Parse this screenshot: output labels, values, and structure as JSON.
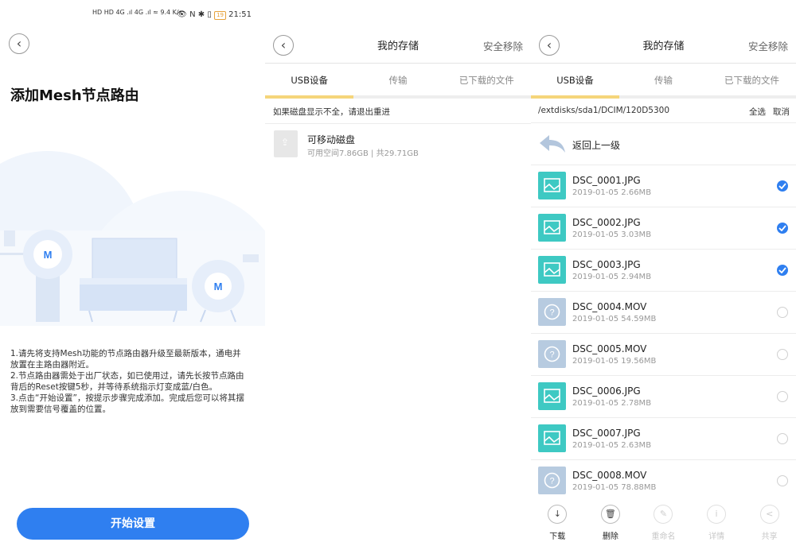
{
  "status_bar": {
    "left_icons": "HD HD 4G .ıl 4G .ıl ≈ 9.4 K/s",
    "right_text": "21:51",
    "battery": "19"
  },
  "panel1": {
    "title": "添加Mesh节点路由",
    "node_logo": "M",
    "instructions": [
      "1.请先将支持Mesh功能的节点路由器升级至最新版本，通电并放置在主路由器附近。",
      "2.节点路由器需处于出厂状态，如已使用过，请先长按节点路由背后的Reset按键5秒，并等待系统指示灯变成蓝/白色。",
      "3.点击“开始设置”，按提示步骤完成添加。完成后您可以将其摆放到需要信号覆盖的位置。"
    ],
    "start_button": "开始设置"
  },
  "panel2": {
    "header_title": "我的存储",
    "header_action": "安全移除",
    "tabs": [
      "USB设备",
      "传输",
      "已下载的文件"
    ],
    "notice": "如果磁盘显示不全，请退出重进",
    "disk": {
      "name": "可移动磁盘",
      "info": "可用空间7.86GB   |   共29.71GB"
    }
  },
  "panel3": {
    "header_title": "我的存储",
    "header_action": "安全移除",
    "tabs": [
      "USB设备",
      "传输",
      "已下载的文件"
    ],
    "path": "/extdisks/sda1/DCIM/120D5300",
    "select_all": "全选",
    "cancel": "取消",
    "up_label": "返回上一级",
    "files": [
      {
        "name": "DSC_0001.JPG",
        "meta": "2019-01-05  2.66MB",
        "type": "image",
        "checked": true
      },
      {
        "name": "DSC_0002.JPG",
        "meta": "2019-01-05  3.03MB",
        "type": "image",
        "checked": true
      },
      {
        "name": "DSC_0003.JPG",
        "meta": "2019-01-05  2.94MB",
        "type": "image",
        "checked": true
      },
      {
        "name": "DSC_0004.MOV",
        "meta": "2019-01-05  54.59MB",
        "type": "video",
        "checked": false
      },
      {
        "name": "DSC_0005.MOV",
        "meta": "2019-01-05  19.56MB",
        "type": "video",
        "checked": false
      },
      {
        "name": "DSC_0006.JPG",
        "meta": "2019-01-05  2.78MB",
        "type": "image",
        "checked": false
      },
      {
        "name": "DSC_0007.JPG",
        "meta": "2019-01-05  2.63MB",
        "type": "image",
        "checked": false
      },
      {
        "name": "DSC_0008.MOV",
        "meta": "2019-01-05  78.88MB",
        "type": "video",
        "checked": false
      }
    ],
    "toolbar": [
      {
        "label": "下载",
        "icon": "download-icon",
        "glyph": "↓",
        "enabled": true
      },
      {
        "label": "删除",
        "icon": "trash-icon",
        "glyph": "🗑",
        "enabled": true
      },
      {
        "label": "重命名",
        "icon": "edit-icon",
        "glyph": "✎",
        "enabled": false
      },
      {
        "label": "详情",
        "icon": "info-icon",
        "glyph": "i",
        "enabled": false
      },
      {
        "label": "共享",
        "icon": "share-icon",
        "glyph": "<",
        "enabled": false
      }
    ]
  },
  "colors": {
    "accent": "#2f7ff0",
    "tab_underline": "#f5d57a",
    "image_thumb": "#3ec9c3",
    "video_thumb": "#b7cbe0"
  }
}
